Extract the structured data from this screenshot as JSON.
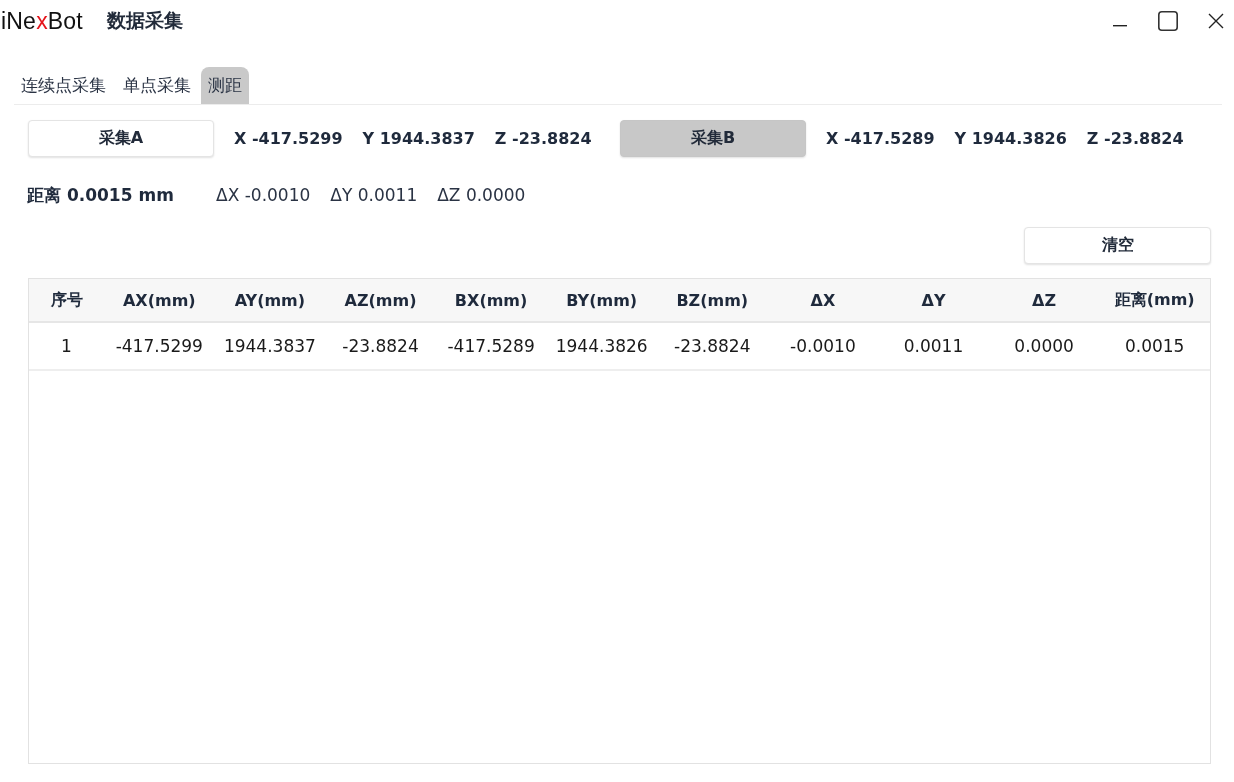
{
  "window": {
    "logo": [
      {
        "text": "iNe",
        "accent": false
      },
      {
        "text": "x",
        "accent": true
      },
      {
        "text": "Bot",
        "accent": false
      }
    ],
    "title": "数据采集"
  },
  "tabs": [
    {
      "label": "连续点采集",
      "selected": false
    },
    {
      "label": "单点采集",
      "selected": false
    },
    {
      "label": "测距",
      "selected": true
    }
  ],
  "capture_points": [
    {
      "button": "采集A",
      "pressed": false,
      "coords": [
        "X -417.5299",
        "Y 1944.3837",
        "Z -23.8824"
      ]
    },
    {
      "button": "采集B",
      "pressed": true,
      "coords": [
        "X -417.5289",
        "Y 1944.3826",
        "Z -23.8824"
      ]
    }
  ],
  "summary": {
    "distance": "距离 0.0015 mm",
    "deltas": [
      "ΔX -0.0010",
      "ΔY 0.0011",
      "ΔZ 0.0000"
    ]
  },
  "clear_button": "清空",
  "table": {
    "columns": [
      "序号",
      "AX(mm)",
      "AY(mm)",
      "AZ(mm)",
      "BX(mm)",
      "BY(mm)",
      "BZ(mm)",
      "ΔX",
      "ΔY",
      "ΔZ",
      "距离(mm)"
    ],
    "rows": [
      [
        "1",
        "-417.5299",
        "1944.3837",
        "-23.8824",
        "-417.5289",
        "1944.3826",
        "-23.8824",
        "-0.0010",
        "0.0011",
        "0.0000",
        "0.0015"
      ]
    ]
  }
}
